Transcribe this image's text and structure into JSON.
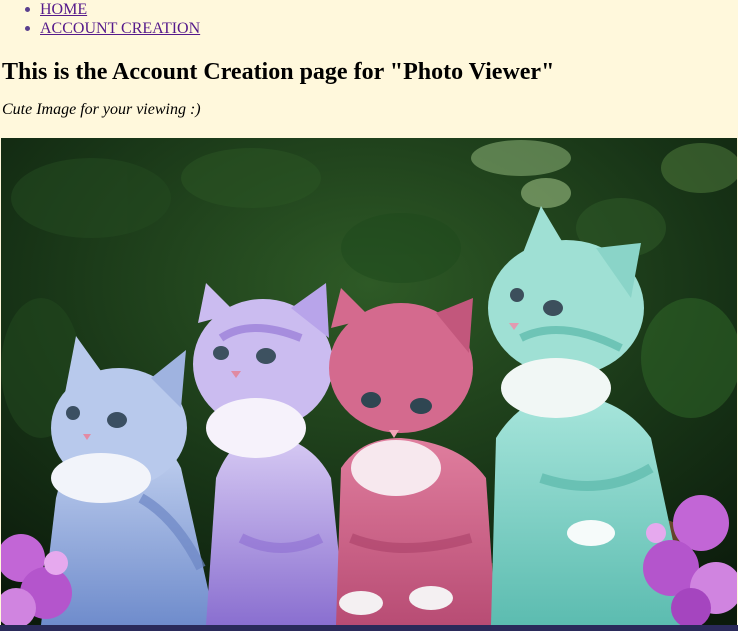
{
  "nav": {
    "items": [
      {
        "label": "HOME"
      },
      {
        "label": "ACCOUNT CREATION"
      }
    ]
  },
  "page": {
    "title": "This is the Account Creation page for \"Photo Viewer\"",
    "caption": "Cute Image for your viewing :)"
  },
  "photo": {
    "alt_subject": "four-colored-kittens-photo",
    "kittens": [
      {
        "color": "#9fb8e0"
      },
      {
        "color": "#b9a6e6"
      },
      {
        "color": "#d0668c"
      },
      {
        "color": "#8fd8cc"
      }
    ],
    "background_color": "#1c3a1a",
    "flower_color": "#c266d6"
  }
}
